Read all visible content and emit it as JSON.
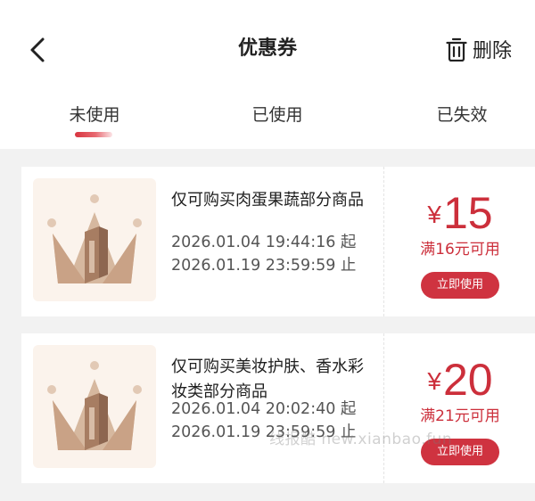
{
  "header": {
    "title": "优惠券",
    "delete_label": "删除",
    "back_icon": "chevron-left-icon",
    "delete_icon": "trash-icon"
  },
  "tabs": [
    {
      "label": "未使用",
      "active": true
    },
    {
      "label": "已使用",
      "active": false
    },
    {
      "label": "已失效",
      "active": false
    }
  ],
  "coupons": [
    {
      "description": "仅可购买肉蛋果蔬部分商品",
      "start": "2026.01.04 19:44:16 起",
      "end": "2026.01.19 23:59:59 止",
      "currency": "¥",
      "amount": "15",
      "condition": "满16元可用",
      "button": "立即使用",
      "thumbnail_icon": "crown-icon"
    },
    {
      "description": "仅可购买美妆护肤、香水彩妆类部分商品",
      "start": "2026.01.04 20:02:40 起",
      "end": "2026.01.19 23:59:59 止",
      "currency": "¥",
      "amount": "20",
      "condition": "满21元可用",
      "button": "立即使用",
      "thumbnail_icon": "crown-icon"
    }
  ],
  "watermark": "线报酷 new.xianbao.fun",
  "colors": {
    "accent": "#cc2f3b",
    "button": "#cf3340",
    "background": "#f2f2f2",
    "thumb_bg": "#fbf3ec",
    "crown": "#c7a58a"
  }
}
